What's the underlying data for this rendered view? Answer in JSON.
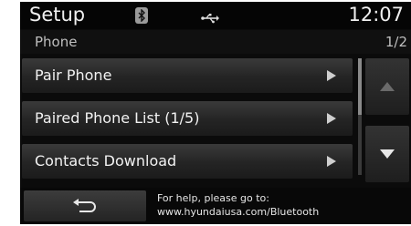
{
  "status": {
    "title": "Setup",
    "clock": "12:07",
    "icons": [
      "bluetooth-icon",
      "usb-icon"
    ]
  },
  "header": {
    "section": "Phone",
    "page": "1/2"
  },
  "menu": [
    {
      "label": "Pair Phone"
    },
    {
      "label": "Paired Phone List (1/5)"
    },
    {
      "label": "Contacts Download"
    }
  ],
  "footer": {
    "help_line1": "For help, please go to:",
    "help_line2": "www.hyundaiusa.com/Bluetooth",
    "back_icon": "back-icon"
  }
}
